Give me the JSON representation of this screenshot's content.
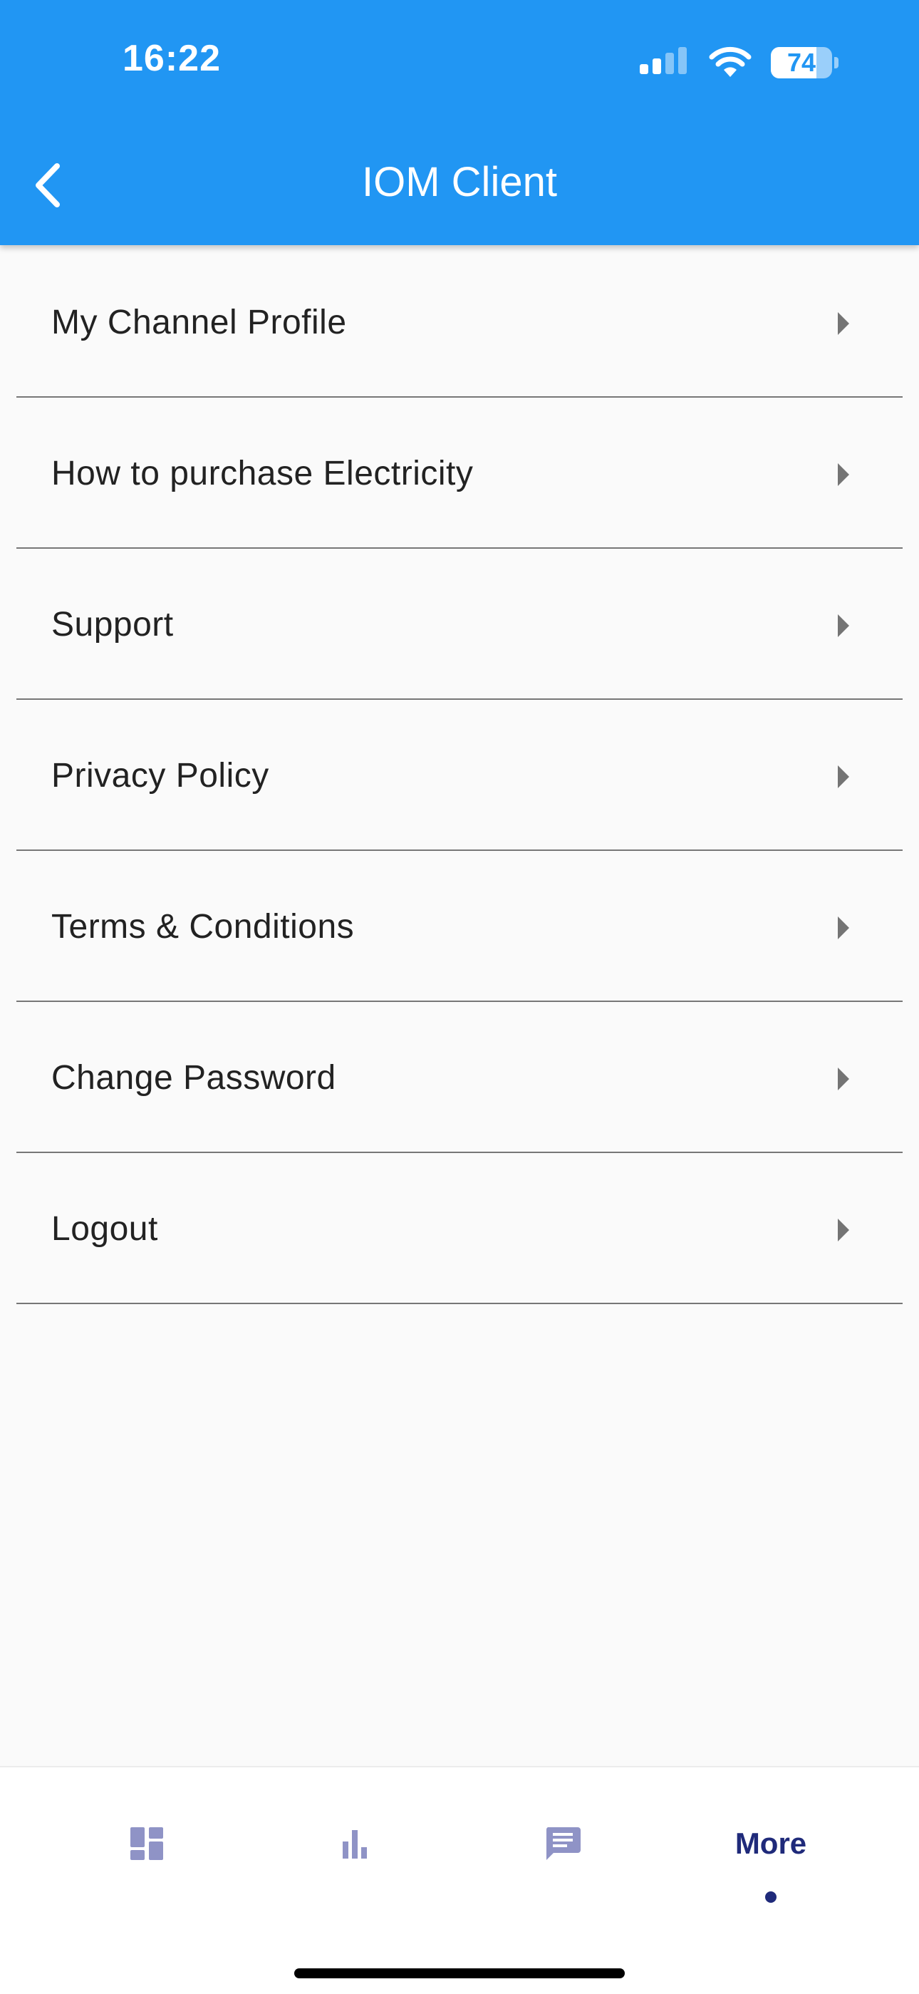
{
  "status_bar": {
    "time": "16:22",
    "battery_level": "74",
    "icons": [
      "cellular-signal-icon",
      "wifi-icon",
      "battery-icon"
    ]
  },
  "app_bar": {
    "title": "IOM Client",
    "back_icon": "chevron-left-icon",
    "background": "#2196f3"
  },
  "menu": {
    "items": [
      {
        "label": "My Channel Profile"
      },
      {
        "label": "How to purchase Electricity"
      },
      {
        "label": "Support"
      },
      {
        "label": "Privacy Policy"
      },
      {
        "label": "Terms & Conditions"
      },
      {
        "label": "Change Password"
      },
      {
        "label": "Logout"
      }
    ],
    "arrow_icon": "arrow-right-icon"
  },
  "bottom_nav": {
    "items": [
      {
        "icon": "dashboard-icon"
      },
      {
        "icon": "bar-chart-icon"
      },
      {
        "icon": "message-icon"
      }
    ],
    "active_label": "More",
    "active_color": "#1f2a7a",
    "inactive_color": "#8f93c6"
  }
}
